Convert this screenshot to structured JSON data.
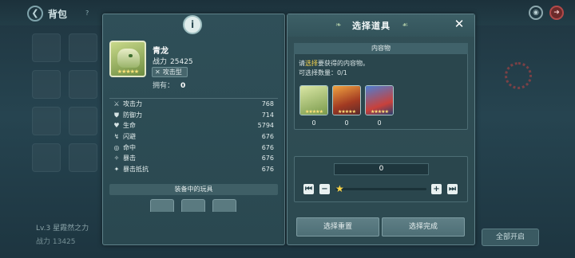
{
  "background": {
    "title": "背包",
    "help": "?",
    "bottom_label": "Lv.3 星霞然之力",
    "bottom_power": "战力 13425",
    "open_all_button": "全部开启"
  },
  "info_panel": {
    "tab_label": "i",
    "pet_name": "青龙",
    "power_label": "战力",
    "power_value": "25425",
    "type_label": "攻击型",
    "owned_label": "拥有：",
    "owned_value": "0",
    "stats": [
      {
        "icon": "sword-icon",
        "label": "攻击力",
        "value": "768"
      },
      {
        "icon": "shield-icon",
        "label": "防御力",
        "value": "714"
      },
      {
        "icon": "heart-icon",
        "label": "生命",
        "value": "5794"
      },
      {
        "icon": "dodge-icon",
        "label": "闪避",
        "value": "676"
      },
      {
        "icon": "target-icon",
        "label": "命中",
        "value": "676"
      },
      {
        "icon": "crit-icon",
        "label": "暴击",
        "value": "676"
      },
      {
        "icon": "crit-resist-icon",
        "label": "暴击抵抗",
        "value": "676"
      }
    ],
    "equip_label": "装备中的玩具"
  },
  "select_panel": {
    "title": "选择道具",
    "close": "✕",
    "content_header": "内容物",
    "hint_prefix": "请",
    "hint_highlight": "选择",
    "hint_suffix": "要获得的内容物。",
    "selectable_label": "可选择数量：",
    "selectable_value": "0/1",
    "items": [
      {
        "name": "green-dragon-item",
        "count": "0"
      },
      {
        "name": "fire-beast-item",
        "count": "0"
      },
      {
        "name": "blue-wolf-item",
        "count": "0"
      }
    ],
    "quantity": "0",
    "reset_button": "选择重置",
    "confirm_button": "选择完成"
  }
}
